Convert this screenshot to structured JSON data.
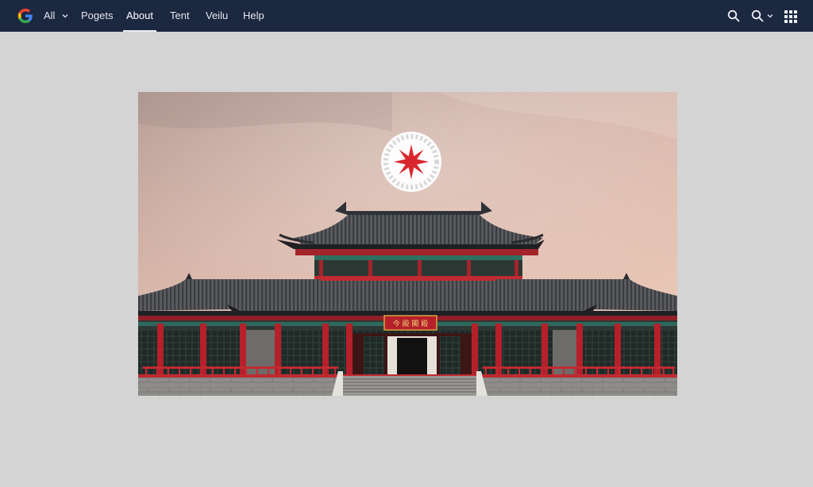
{
  "nav": {
    "all_label": "All",
    "items": [
      {
        "label": "Pogets"
      },
      {
        "label": "About",
        "active": true
      },
      {
        "label": "Tent"
      },
      {
        "label": "Veilu"
      },
      {
        "label": "Help"
      }
    ]
  },
  "toolbar": {
    "search_icon": "search-icon",
    "search_menu_icon": "search-icon",
    "apps_icon": "apps-grid-icon"
  },
  "hero": {
    "sign_text": "今 殿 閣 殿",
    "emblem_icon": "flower-emblem-icon"
  },
  "colors": {
    "topbar": "#1c2740",
    "background": "#d4d4d4",
    "accent_red": "#b5202a",
    "sky": "#d7b1a5"
  }
}
